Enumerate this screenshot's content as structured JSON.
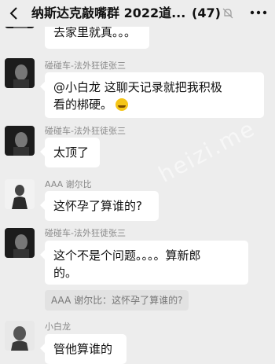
{
  "header": {
    "title": "纳斯达克敲嘴群 2022道...",
    "count": "(47)",
    "back_icon": "chevron-left-icon",
    "mute_icon": "bell-mute-icon",
    "more_icon": "more-dots-icon"
  },
  "messages": [
    {
      "sender": "",
      "text": "去家里就真。。。"
    },
    {
      "sender": "碰碰车-法外狂徒张三",
      "text_lines": [
        "@小白龙 这聊天记录就把我积极",
        "看的梆硬。"
      ],
      "emoji": "laughing-emoji"
    },
    {
      "sender": "碰碰车-法外狂徒张三",
      "text": "太顶了"
    },
    {
      "sender": "AAA 谢尔比",
      "text": "这怀孕了算谁的?"
    },
    {
      "sender": "碰碰车-法外狂徒张三",
      "text_lines": [
        "这个不是个问题。。。。算新郎",
        "的。"
      ],
      "quote": "AAA 谢尔比：这怀孕了算谁的?"
    },
    {
      "sender": "小白龙",
      "text": "管他算谁的"
    }
  ],
  "watermark": "heizi.me"
}
